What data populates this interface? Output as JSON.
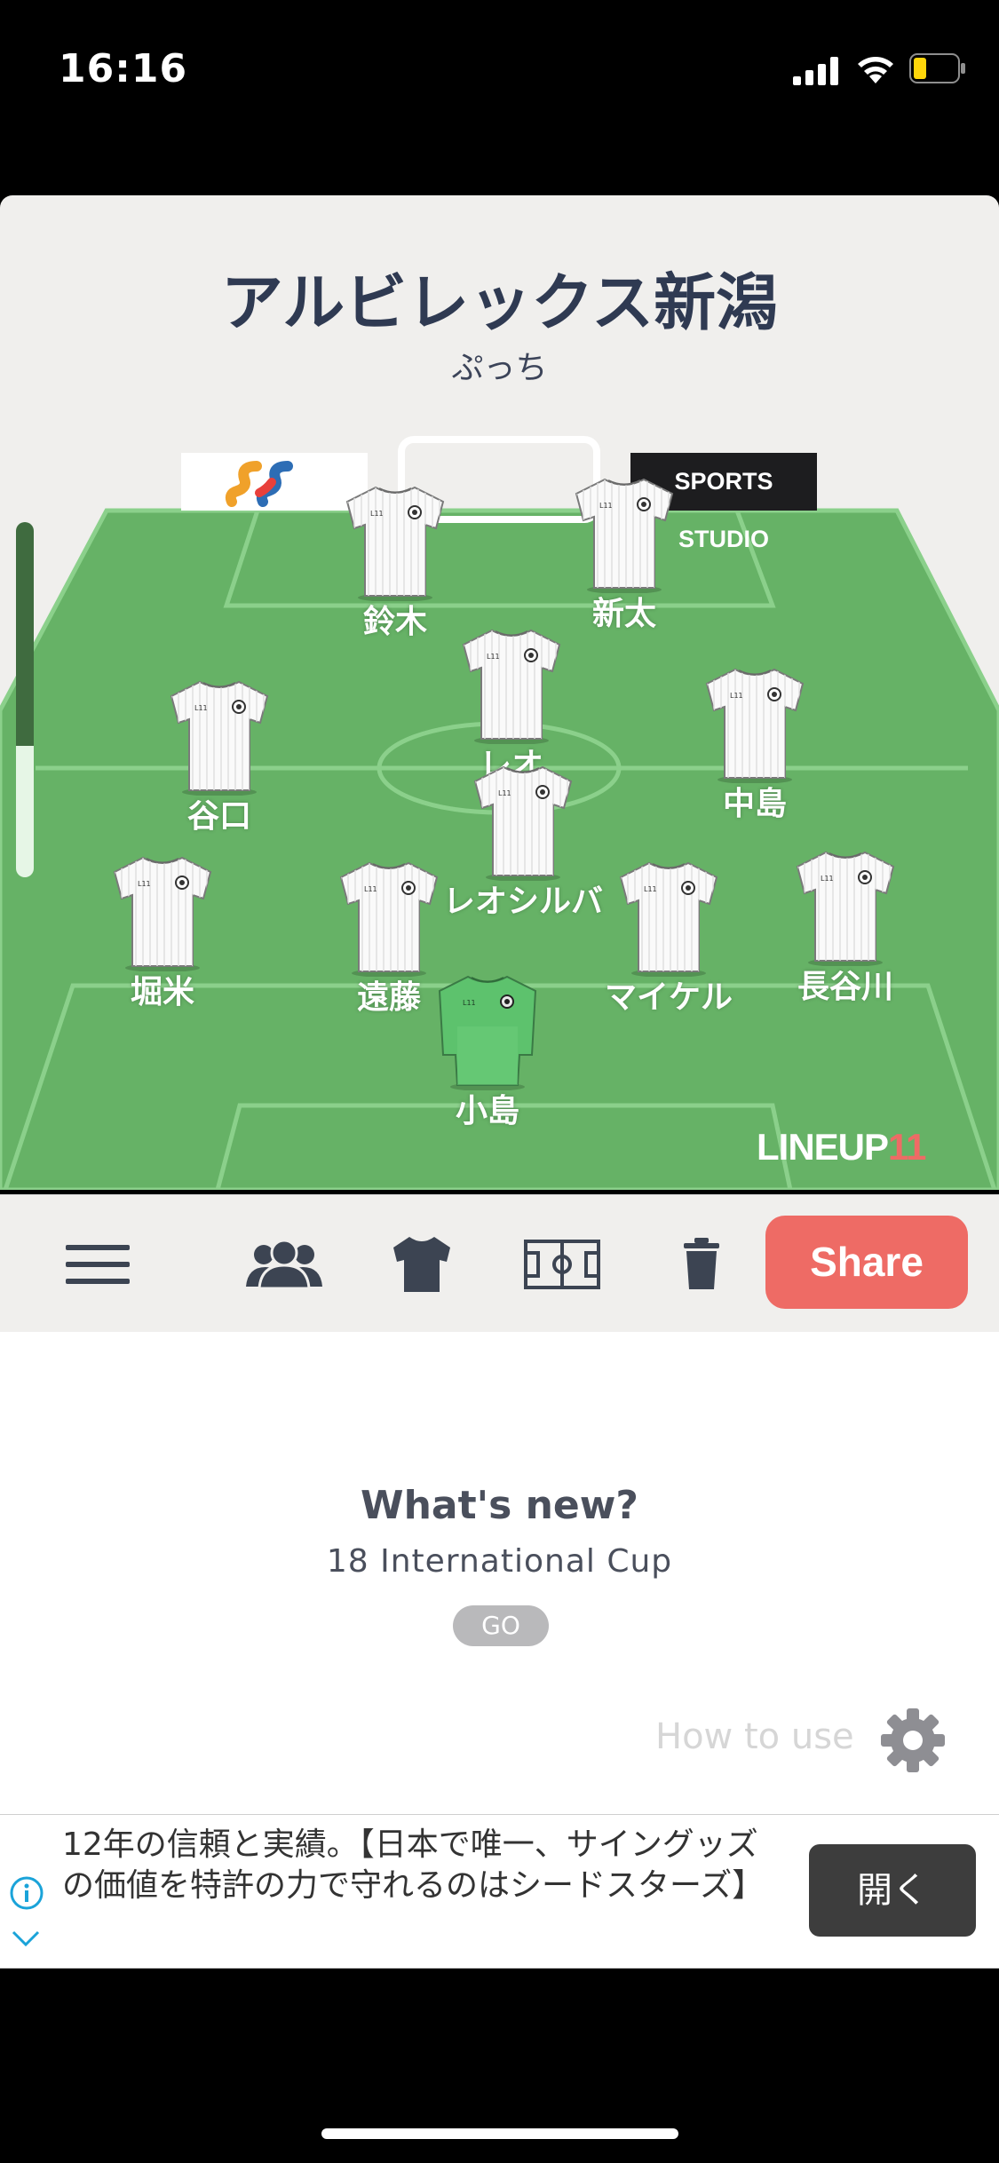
{
  "status": {
    "time": "16:16"
  },
  "team": {
    "name": "アルビレックス新潟",
    "subtitle": "ぷっち"
  },
  "sponsors": {
    "right": "SPORTS STUDIO"
  },
  "players": [
    {
      "name": "鈴木",
      "role": "field"
    },
    {
      "name": "新太",
      "role": "field"
    },
    {
      "name": "レオ",
      "role": "field"
    },
    {
      "name": "谷口",
      "role": "field"
    },
    {
      "name": "中島",
      "role": "field"
    },
    {
      "name": "レオシルバ",
      "role": "field"
    },
    {
      "name": "堀米",
      "role": "field"
    },
    {
      "name": "遠藤",
      "role": "field"
    },
    {
      "name": "マイケル",
      "role": "field"
    },
    {
      "name": "長谷川",
      "role": "field"
    },
    {
      "name": "小島",
      "role": "goalkeeper"
    }
  ],
  "slider": {
    "level_fraction": 0.37
  },
  "branding": {
    "logo_text": "LINEUP",
    "logo_number": "11"
  },
  "toolbar": {
    "menu_icon": "hamburger-icon",
    "team_icon": "people-icon",
    "kit_icon": "shirt-icon",
    "pitch_icon": "pitch-icon",
    "delete_icon": "trash-icon",
    "share_label": "Share"
  },
  "news": {
    "title": "What's new?",
    "subtitle": "18 International Cup",
    "go_label": "GO"
  },
  "help": {
    "label": "How to use",
    "icon": "gear-icon"
  },
  "ad": {
    "text": "12年の信頼と実績。【日本で唯一、サイングッズの価値を特許の力で守れるのはシードスターズ】",
    "button": "開く"
  },
  "colors": {
    "pitch": "#66b266",
    "accent": "#ee6b65",
    "title": "#2f3a52",
    "goalkeeper": "#5dc26d"
  }
}
